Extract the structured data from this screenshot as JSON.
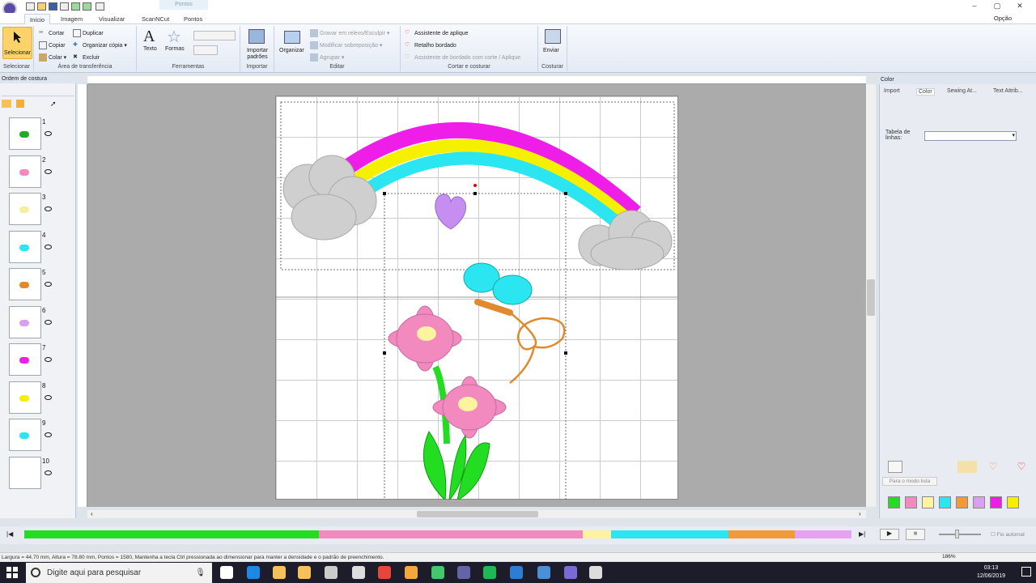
{
  "titlebar": {
    "context_tab": "Pontos"
  },
  "menu": {
    "tabs": [
      "Início",
      "Imagem",
      "Visualizar",
      "ScanNCut",
      "Pontos"
    ],
    "option": "Opção"
  },
  "ribbon": {
    "select_label": "Selecionar",
    "select_group": "Selecionar",
    "clipboard": {
      "cut": "Cortar",
      "copy": "Copiar",
      "paste": "Colar",
      "duplicate": "Duplicar",
      "arrange_copy": "Organizar cópia",
      "delete": "Excluir",
      "group": "Área de transferência"
    },
    "tools": {
      "text": "Texto",
      "shapes": "Formas",
      "group": "Ferramentas"
    },
    "import": {
      "label": "Importar padrões",
      "group": "Importar"
    },
    "edit": {
      "organize": "Organizar",
      "emboss": "Gravar em relevo/Esculpir",
      "modify_overlap": "Modificar sobreposição",
      "group_items": "Agrupar",
      "group": "Editar"
    },
    "cut_sew": {
      "applique": "Assistente de aplique",
      "patch": "Retalho bordado",
      "cut_applique": "Assistente de bordado com corte / Aplique",
      "group": "Cortar e costurar"
    },
    "send": {
      "label": "Enviar",
      "group": "Costurar"
    }
  },
  "left_panel": {
    "title": "Ordem de costura",
    "items": [
      "1",
      "2",
      "3",
      "4",
      "5",
      "6",
      "7",
      "8",
      "9",
      "10"
    ]
  },
  "right_panel": {
    "title": "Color",
    "tabs": [
      "Import",
      "Color",
      "Sewing At...",
      "Text Attrib..."
    ],
    "table_label": "Tabela de linhas:",
    "list_mode": "Para o modo lista",
    "swatches": [
      "#22dd22",
      "#f28ac0",
      "#fff3a0",
      "#2be6f0",
      "#f29a3a",
      "#d8a0f0",
      "#ee1ee8",
      "#f5f000"
    ]
  },
  "colorbar": {
    "colors": [
      "#22dd22",
      "#f28ac0",
      "#fff3a0",
      "#2be6f0",
      "#f29a3a",
      "#e8a0f0"
    ],
    "auto_label": "Fio automat"
  },
  "statusbar": {
    "text": "Largura = 44.70 mm, Altura = 78.80 mm, Pontos = 1580, Mantenha a tecla Ctrl pressionada ao dimensionar para manter a densidade e o padrão de preenchimento.",
    "zoom": "186%"
  },
  "taskbar": {
    "search": "Digite aqui para pesquisar",
    "time": "03:13",
    "date": "12/06/2019"
  }
}
